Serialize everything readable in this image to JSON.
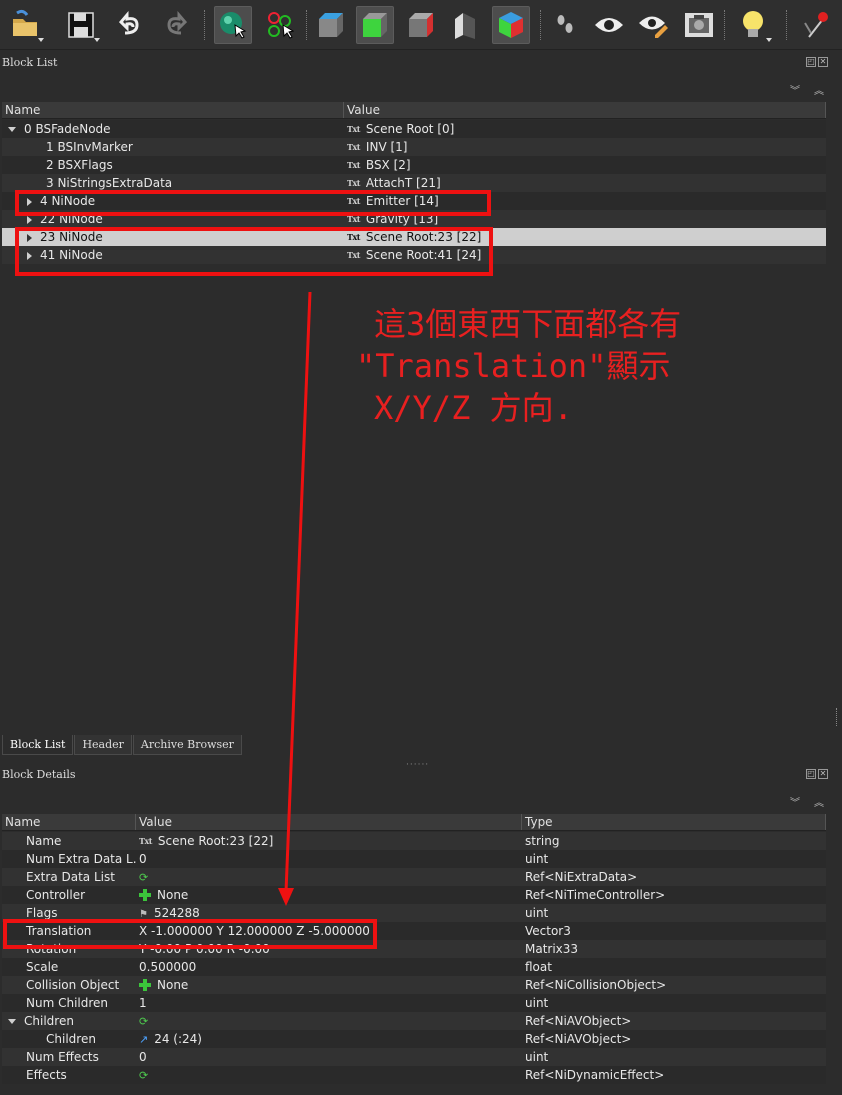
{
  "toolbar": {
    "buttons": [
      {
        "name": "load-icon"
      },
      {
        "name": "save-icon"
      },
      {
        "name": "undo-icon"
      },
      {
        "name": "redo-icon"
      },
      {
        "name": "select-object-icon"
      },
      {
        "name": "select-vertex-icon"
      },
      {
        "name": "front-view-icon"
      },
      {
        "name": "side-view-icon"
      },
      {
        "name": "back-view-icon"
      },
      {
        "name": "orientation-icon"
      },
      {
        "name": "perspective-cube-icon"
      },
      {
        "name": "walk-icon"
      },
      {
        "name": "view-eye-icon"
      },
      {
        "name": "edit-eye-icon"
      },
      {
        "name": "screenshot-icon"
      },
      {
        "name": "lighting-icon"
      },
      {
        "name": "pin-icon"
      }
    ]
  },
  "block_list": {
    "panel_title": "Block List",
    "columns": [
      "Name",
      "Value"
    ],
    "rows": [
      {
        "name": "0 BSFadeNode",
        "value": "Scene Root [0]",
        "indent": 0,
        "expander": "open"
      },
      {
        "name": "1 BSInvMarker",
        "value": "INV [1]",
        "indent": 1,
        "expander": "none"
      },
      {
        "name": "2 BSXFlags",
        "value": "BSX [2]",
        "indent": 1,
        "expander": "none"
      },
      {
        "name": "3 NiStringsExtraData",
        "value": "AttachT [21]",
        "indent": 1,
        "expander": "none"
      },
      {
        "name": "4 NiNode",
        "value": "Emitter [14]",
        "indent": 1,
        "expander": "closed"
      },
      {
        "name": "22 NiNode",
        "value": "Gravity [13]",
        "indent": 1,
        "expander": "closed"
      },
      {
        "name": "23 NiNode",
        "value": "Scene Root:23 [22]",
        "indent": 1,
        "expander": "closed",
        "selected": true
      },
      {
        "name": "41 NiNode",
        "value": "Scene Root:41 [24]",
        "indent": 1,
        "expander": "closed"
      }
    ]
  },
  "tabs": [
    "Block List",
    "Header",
    "Archive Browser"
  ],
  "block_details": {
    "panel_title": "Block Details",
    "columns": [
      "Name",
      "Value",
      "Type"
    ],
    "rows": [
      {
        "name": "Name",
        "value": "Scene Root:23 [22]",
        "type": "string",
        "icon": "txt",
        "indent": 1
      },
      {
        "name": "Num Extra Data L...",
        "value": "0",
        "type": "uint",
        "icon": "",
        "indent": 1
      },
      {
        "name": "Extra Data List",
        "value": "",
        "type": "Ref<NiExtraData>",
        "icon": "cycle",
        "indent": 1
      },
      {
        "name": "Controller",
        "value": "None",
        "type": "Ref<NiTimeController>",
        "icon": "plus",
        "indent": 1
      },
      {
        "name": "Flags",
        "value": "524288",
        "type": "uint",
        "icon": "flag",
        "indent": 1
      },
      {
        "name": "Translation",
        "value": "X -1.000000 Y 12.000000 Z -5.000000",
        "type": "Vector3",
        "icon": "",
        "indent": 1
      },
      {
        "name": "Rotation",
        "value": "Y -0.00 P 0.00 R -0.00",
        "type": "Matrix33",
        "icon": "",
        "indent": 1
      },
      {
        "name": "Scale",
        "value": "0.500000",
        "type": "float",
        "icon": "",
        "indent": 1
      },
      {
        "name": "Collision Object",
        "value": "None",
        "type": "Ref<NiCollisionObject>",
        "icon": "plus",
        "indent": 1
      },
      {
        "name": "Num Children",
        "value": "1",
        "type": "uint",
        "icon": "",
        "indent": 1
      },
      {
        "name": "Children",
        "value": "",
        "type": "Ref<NiAVObject>",
        "icon": "cycle",
        "indent": 0,
        "expander": "open"
      },
      {
        "name": "Children",
        "value": "24 (:24)",
        "type": "Ref<NiAVObject>",
        "icon": "link",
        "indent": 2
      },
      {
        "name": "Num Effects",
        "value": "0",
        "type": "uint",
        "icon": "",
        "indent": 1
      },
      {
        "name": "Effects",
        "value": "",
        "type": "Ref<NiDynamicEffect>",
        "icon": "cycle",
        "indent": 1
      }
    ]
  },
  "annotation": {
    "text_line1": "這3個東西下面都各有",
    "text_line2": "\"Translation\"顯示",
    "text_line3": "X/Y/Z 方向.",
    "color": "#ee1111"
  }
}
